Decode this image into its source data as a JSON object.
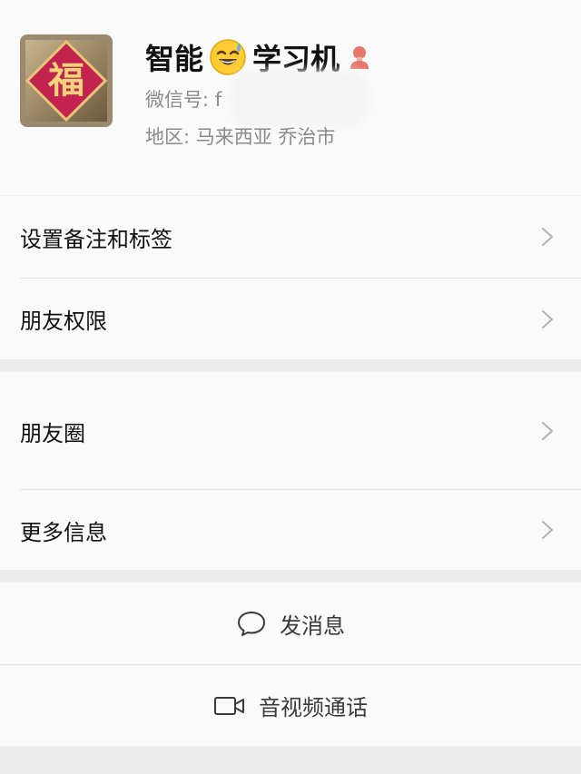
{
  "profile": {
    "name_part1": "智能",
    "name_part2": "学习机",
    "emoji_icon": "sweat-smile-emoji-icon",
    "gender_icon": "female-person-icon",
    "wechat_id_label": "微信号: f",
    "region_text": "地区: 马来西亚  乔治市",
    "avatar_glyph": "福"
  },
  "section1": {
    "items": [
      {
        "label": "设置备注和标签"
      },
      {
        "label": "朋友权限"
      }
    ]
  },
  "section2": {
    "items": [
      {
        "label": "朋友圈"
      },
      {
        "label": "更多信息"
      }
    ]
  },
  "actions": {
    "message_label": "发消息",
    "message_icon": "chat-bubble-icon",
    "call_label": "音视频通话",
    "call_icon": "video-camera-icon"
  },
  "colors": {
    "background": "#ededed",
    "card": "#fafafa",
    "secondary_text": "#8a8a8a",
    "gender_icon": "#e8766a"
  }
}
